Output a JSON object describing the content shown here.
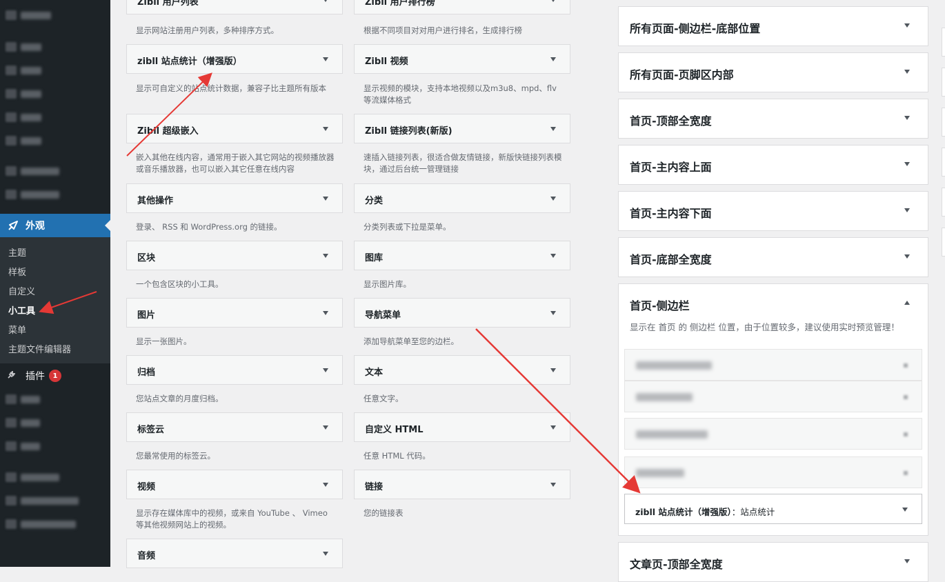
{
  "sidebar": {
    "appearance_label": "外观",
    "submenu": [
      "主题",
      "样板",
      "自定义",
      "小工具",
      "菜单",
      "主题文件编辑器"
    ],
    "active_item": "小工具",
    "plugins_label": "插件",
    "plugins_badge": "1"
  },
  "widgets": [
    {
      "title": "Zibll 用户列表",
      "desc": "显示网站注册用户列表，多种排序方式。"
    },
    {
      "title": "Zibll 用户排行榜",
      "desc": "根据不同项目对对用户进行排名，生成排行榜"
    },
    {
      "title": "zibll 站点统计（增强版）",
      "desc": "显示可自定义的站点统计数据，兼容子比主题所有版本"
    },
    {
      "title": "Zibll 视频",
      "desc": "显示视频的模块，支持本地视频以及m3u8、mpd、flv等流媒体格式"
    },
    {
      "title": "Zibll 超级嵌入",
      "desc": "嵌入其他在线内容，通常用于嵌入其它网站的视频播放器或音乐播放器，也可以嵌入其它任意在线内容"
    },
    {
      "title": "Zibll 链接列表(新版)",
      "desc": "速插入链接列表，很适合做友情链接，新版快链接列表模块，通过后台统一管理链接"
    },
    {
      "title": "其他操作",
      "desc": "登录、 RSS 和 WordPress.org 的链接。"
    },
    {
      "title": "分类",
      "desc": "分类列表或下拉是菜单。"
    },
    {
      "title": "区块",
      "desc": "一个包含区块的小工具。"
    },
    {
      "title": "图库",
      "desc": "显示图片库。"
    },
    {
      "title": "图片",
      "desc": "显示一张图片。"
    },
    {
      "title": "导航菜单",
      "desc": "添加导航菜单至您的边栏。"
    },
    {
      "title": "归档",
      "desc": "您站点文章的月度归档。"
    },
    {
      "title": "文本",
      "desc": "任意文字。"
    },
    {
      "title": "标签云",
      "desc": "您最常使用的标签云。"
    },
    {
      "title": "自定义 HTML",
      "desc": "任意 HTML 代码。"
    },
    {
      "title": "视频",
      "desc": "显示存在媒体库中的视频，或来自 YouTube 、 Vimeo 等其他视频网站上的视频。"
    },
    {
      "title": "链接",
      "desc": "您的链接表"
    },
    {
      "title": "音频",
      "desc": ""
    }
  ],
  "areas": [
    {
      "title": "所有页面-侧边栏-底部位置"
    },
    {
      "title": "所有页面-页脚区内部"
    },
    {
      "title": "首页-顶部全宽度"
    },
    {
      "title": "首页-主内容上面"
    },
    {
      "title": "首页-主内容下面"
    },
    {
      "title": "首页-底部全宽度"
    },
    {
      "title": "首页-侧边栏",
      "desc": "显示在 首页 的 侧边栏 位置，由于位置较多，建议使用实时预览管理！"
    },
    {
      "title": "文章页-顶部全宽度"
    }
  ],
  "placed_widget": {
    "title": "zibll 站点统计（增强版）",
    "instance": "：站点统计"
  },
  "colors": {
    "accent": "#2271b1",
    "admin_dark": "#1d2327",
    "badge": "#d63638",
    "arrow": "#e53935"
  }
}
